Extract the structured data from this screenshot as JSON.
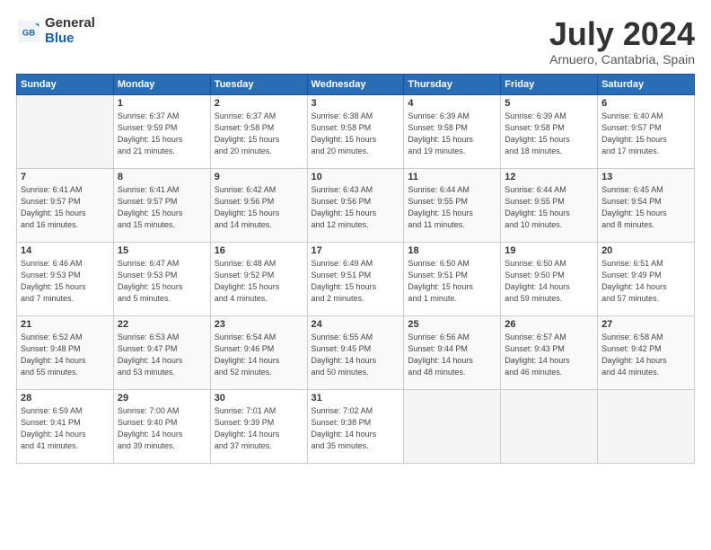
{
  "logo": {
    "general": "General",
    "blue": "Blue"
  },
  "title": "July 2024",
  "subtitle": "Arnuero, Cantabria, Spain",
  "headers": [
    "Sunday",
    "Monday",
    "Tuesday",
    "Wednesday",
    "Thursday",
    "Friday",
    "Saturday"
  ],
  "weeks": [
    [
      {
        "day": "",
        "info": ""
      },
      {
        "day": "1",
        "info": "Sunrise: 6:37 AM\nSunset: 9:59 PM\nDaylight: 15 hours\nand 21 minutes."
      },
      {
        "day": "2",
        "info": "Sunrise: 6:37 AM\nSunset: 9:58 PM\nDaylight: 15 hours\nand 20 minutes."
      },
      {
        "day": "3",
        "info": "Sunrise: 6:38 AM\nSunset: 9:58 PM\nDaylight: 15 hours\nand 20 minutes."
      },
      {
        "day": "4",
        "info": "Sunrise: 6:39 AM\nSunset: 9:58 PM\nDaylight: 15 hours\nand 19 minutes."
      },
      {
        "day": "5",
        "info": "Sunrise: 6:39 AM\nSunset: 9:58 PM\nDaylight: 15 hours\nand 18 minutes."
      },
      {
        "day": "6",
        "info": "Sunrise: 6:40 AM\nSunset: 9:57 PM\nDaylight: 15 hours\nand 17 minutes."
      }
    ],
    [
      {
        "day": "7",
        "info": "Sunrise: 6:41 AM\nSunset: 9:57 PM\nDaylight: 15 hours\nand 16 minutes."
      },
      {
        "day": "8",
        "info": "Sunrise: 6:41 AM\nSunset: 9:57 PM\nDaylight: 15 hours\nand 15 minutes."
      },
      {
        "day": "9",
        "info": "Sunrise: 6:42 AM\nSunset: 9:56 PM\nDaylight: 15 hours\nand 14 minutes."
      },
      {
        "day": "10",
        "info": "Sunrise: 6:43 AM\nSunset: 9:56 PM\nDaylight: 15 hours\nand 12 minutes."
      },
      {
        "day": "11",
        "info": "Sunrise: 6:44 AM\nSunset: 9:55 PM\nDaylight: 15 hours\nand 11 minutes."
      },
      {
        "day": "12",
        "info": "Sunrise: 6:44 AM\nSunset: 9:55 PM\nDaylight: 15 hours\nand 10 minutes."
      },
      {
        "day": "13",
        "info": "Sunrise: 6:45 AM\nSunset: 9:54 PM\nDaylight: 15 hours\nand 8 minutes."
      }
    ],
    [
      {
        "day": "14",
        "info": "Sunrise: 6:46 AM\nSunset: 9:53 PM\nDaylight: 15 hours\nand 7 minutes."
      },
      {
        "day": "15",
        "info": "Sunrise: 6:47 AM\nSunset: 9:53 PM\nDaylight: 15 hours\nand 5 minutes."
      },
      {
        "day": "16",
        "info": "Sunrise: 6:48 AM\nSunset: 9:52 PM\nDaylight: 15 hours\nand 4 minutes."
      },
      {
        "day": "17",
        "info": "Sunrise: 6:49 AM\nSunset: 9:51 PM\nDaylight: 15 hours\nand 2 minutes."
      },
      {
        "day": "18",
        "info": "Sunrise: 6:50 AM\nSunset: 9:51 PM\nDaylight: 15 hours\nand 1 minute."
      },
      {
        "day": "19",
        "info": "Sunrise: 6:50 AM\nSunset: 9:50 PM\nDaylight: 14 hours\nand 59 minutes."
      },
      {
        "day": "20",
        "info": "Sunrise: 6:51 AM\nSunset: 9:49 PM\nDaylight: 14 hours\nand 57 minutes."
      }
    ],
    [
      {
        "day": "21",
        "info": "Sunrise: 6:52 AM\nSunset: 9:48 PM\nDaylight: 14 hours\nand 55 minutes."
      },
      {
        "day": "22",
        "info": "Sunrise: 6:53 AM\nSunset: 9:47 PM\nDaylight: 14 hours\nand 53 minutes."
      },
      {
        "day": "23",
        "info": "Sunrise: 6:54 AM\nSunset: 9:46 PM\nDaylight: 14 hours\nand 52 minutes."
      },
      {
        "day": "24",
        "info": "Sunrise: 6:55 AM\nSunset: 9:45 PM\nDaylight: 14 hours\nand 50 minutes."
      },
      {
        "day": "25",
        "info": "Sunrise: 6:56 AM\nSunset: 9:44 PM\nDaylight: 14 hours\nand 48 minutes."
      },
      {
        "day": "26",
        "info": "Sunrise: 6:57 AM\nSunset: 9:43 PM\nDaylight: 14 hours\nand 46 minutes."
      },
      {
        "day": "27",
        "info": "Sunrise: 6:58 AM\nSunset: 9:42 PM\nDaylight: 14 hours\nand 44 minutes."
      }
    ],
    [
      {
        "day": "28",
        "info": "Sunrise: 6:59 AM\nSunset: 9:41 PM\nDaylight: 14 hours\nand 41 minutes."
      },
      {
        "day": "29",
        "info": "Sunrise: 7:00 AM\nSunset: 9:40 PM\nDaylight: 14 hours\nand 39 minutes."
      },
      {
        "day": "30",
        "info": "Sunrise: 7:01 AM\nSunset: 9:39 PM\nDaylight: 14 hours\nand 37 minutes."
      },
      {
        "day": "31",
        "info": "Sunrise: 7:02 AM\nSunset: 9:38 PM\nDaylight: 14 hours\nand 35 minutes."
      },
      {
        "day": "",
        "info": ""
      },
      {
        "day": "",
        "info": ""
      },
      {
        "day": "",
        "info": ""
      }
    ]
  ]
}
